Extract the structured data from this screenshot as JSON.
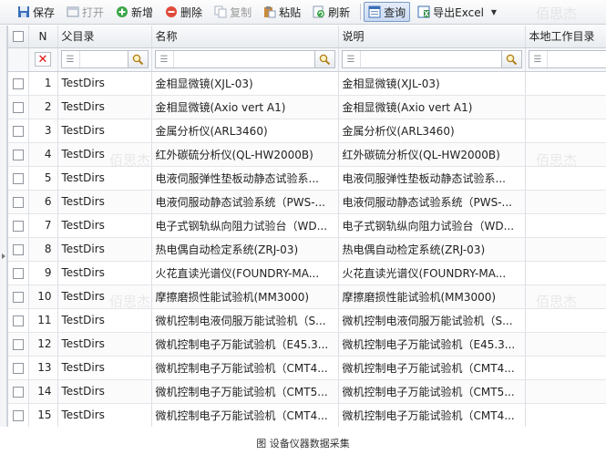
{
  "toolbar": {
    "save": "保存",
    "open": "打开",
    "add": "新增",
    "delete": "删除",
    "copy": "复制",
    "paste": "粘贴",
    "refresh": "刷新",
    "query": "查询",
    "export": "导出Excel"
  },
  "columns": {
    "num": "N",
    "parent": "父目录",
    "name": "名称",
    "desc": "说明",
    "local": "本地工作目录"
  },
  "rows": [
    {
      "n": "1",
      "parent": "TestDirs",
      "name": "金相显微镜(XJL-03)",
      "desc": "金相显微镜(XJL-03)"
    },
    {
      "n": "2",
      "parent": "TestDirs",
      "name": "金相显微镜(Axio vert A1)",
      "desc": "金相显微镜(Axio vert A1)"
    },
    {
      "n": "3",
      "parent": "TestDirs",
      "name": "金属分析仪(ARL3460)",
      "desc": "金属分析仪(ARL3460)"
    },
    {
      "n": "4",
      "parent": "TestDirs",
      "name": "红外碳硫分析仪(QL-HW2000B)",
      "desc": "红外碳硫分析仪(QL-HW2000B)"
    },
    {
      "n": "5",
      "parent": "TestDirs",
      "name": "电液伺服弹性垫板动静态试验系...",
      "desc": "电液伺服弹性垫板动静态试验系..."
    },
    {
      "n": "6",
      "parent": "TestDirs",
      "name": "电液伺服动静态试验系统（PWS-...",
      "desc": "电液伺服动静态试验系统（PWS-..."
    },
    {
      "n": "7",
      "parent": "TestDirs",
      "name": "电子式钢轨纵向阻力试验台（WD...",
      "desc": "电子式钢轨纵向阻力试验台（WD..."
    },
    {
      "n": "8",
      "parent": "TestDirs",
      "name": "热电偶自动检定系统(ZRJ-03)",
      "desc": "热电偶自动检定系统(ZRJ-03)"
    },
    {
      "n": "9",
      "parent": "TestDirs",
      "name": "火花直读光谱仪(FOUNDRY-MA...",
      "desc": "火花直读光谱仪(FOUNDRY-MA..."
    },
    {
      "n": "10",
      "parent": "TestDirs",
      "name": "摩擦磨损性能试验机(MM3000)",
      "desc": "摩擦磨损性能试验机(MM3000)"
    },
    {
      "n": "11",
      "parent": "TestDirs",
      "name": "微机控制电液伺服万能试验机（S...",
      "desc": "微机控制电液伺服万能试验机（S..."
    },
    {
      "n": "12",
      "parent": "TestDirs",
      "name": "微机控制电子万能试验机（E45.3...",
      "desc": "微机控制电子万能试验机（E45.3..."
    },
    {
      "n": "13",
      "parent": "TestDirs",
      "name": "微机控制电子万能试验机（CMT4...",
      "desc": "微机控制电子万能试验机（CMT4..."
    },
    {
      "n": "14",
      "parent": "TestDirs",
      "name": "微机控制电子万能试验机（CMT5...",
      "desc": "微机控制电子万能试验机（CMT5..."
    },
    {
      "n": "15",
      "parent": "TestDirs",
      "name": "微机控制电子万能试验机（CMT4...",
      "desc": "微机控制电子万能试验机（CMT4..."
    }
  ],
  "caption": "图 设备仪器数据采集",
  "watermark": "佰思杰"
}
